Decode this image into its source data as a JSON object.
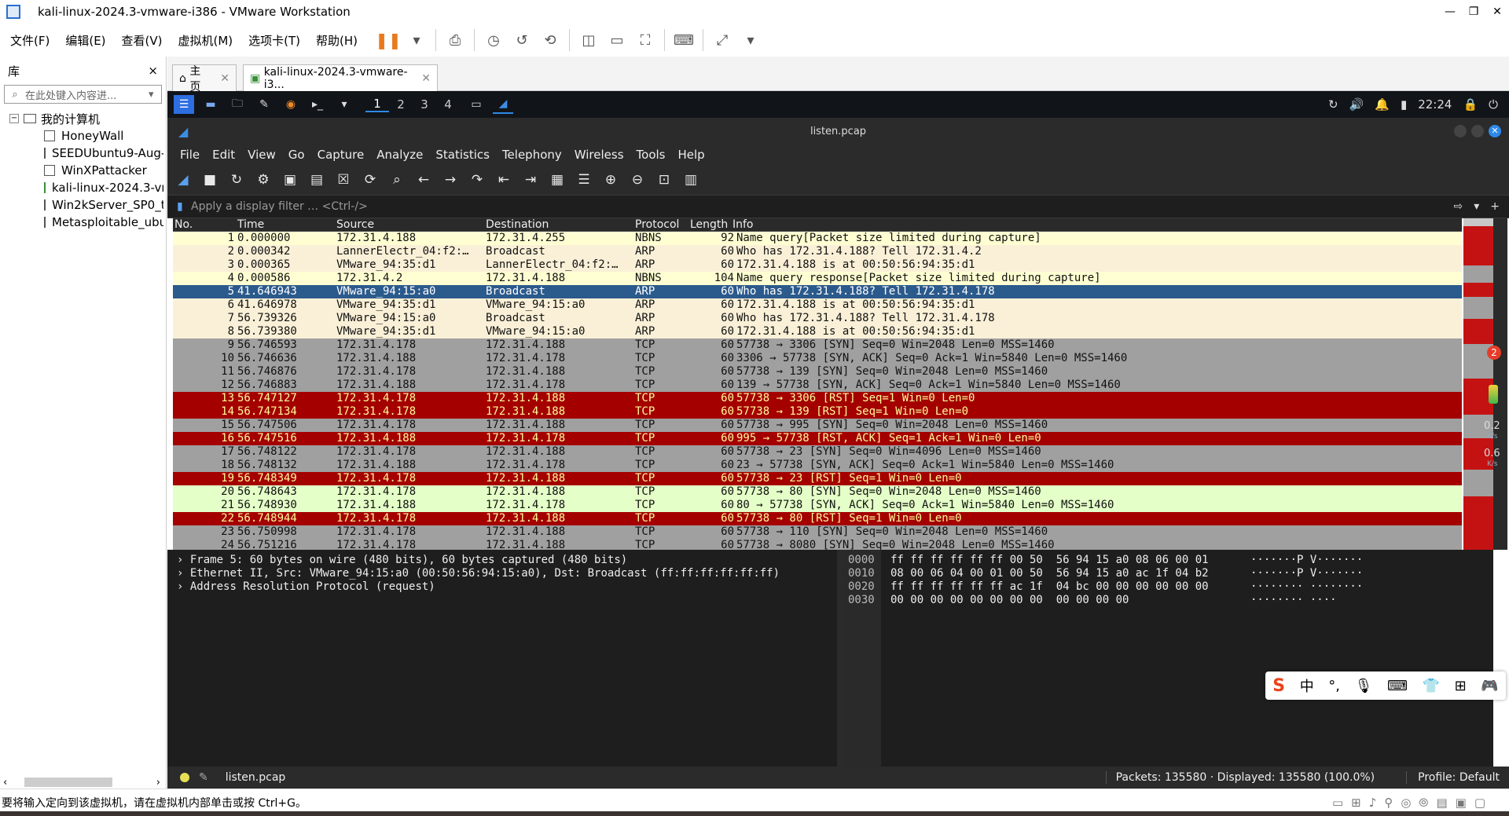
{
  "window": {
    "title": "kali-linux-2024.3-vmware-i386 - VMware Workstation"
  },
  "menubar": {
    "items": [
      "文件(F)",
      "编辑(E)",
      "查看(V)",
      "虚拟机(M)",
      "选项卡(T)",
      "帮助(H)"
    ]
  },
  "library": {
    "title": "库",
    "close": "×",
    "search_placeholder": "在此处键入内容进...",
    "root": "我的计算机",
    "vms": [
      "HoneyWall",
      "SEEDUbuntu9-Aug-2010",
      "WinXPattacker",
      "kali-linux-2024.3-vmware-i386",
      "Win2kServer_SP0_target",
      "Metasploitable_ubuntu"
    ]
  },
  "tabs": {
    "home": "主页",
    "vm": "kali-linux-2024.3-vmware-i3..."
  },
  "kali_panel": {
    "workspaces": [
      "1",
      "2",
      "3",
      "4"
    ],
    "clock": "22:24"
  },
  "wireshark": {
    "title": "listen.pcap",
    "menu": [
      "File",
      "Edit",
      "View",
      "Go",
      "Capture",
      "Analyze",
      "Statistics",
      "Telephony",
      "Wireless",
      "Tools",
      "Help"
    ],
    "filter_placeholder": "Apply a display filter … <Ctrl-/>",
    "columns": {
      "no": "No.",
      "time": "Time",
      "source": "Source",
      "destination": "Destination",
      "protocol": "Protocol",
      "length": "Length",
      "info": "Info"
    },
    "packets": [
      {
        "no": "1",
        "time": "0.000000",
        "src": "172.31.4.188",
        "dst": "172.31.4.255",
        "proto": "NBNS",
        "len": "92",
        "info": "Name query[Packet size limited during capture]",
        "cls": "r-nbns"
      },
      {
        "no": "2",
        "time": "0.000342",
        "src": "LannerElectr_04:f2:…",
        "dst": "Broadcast",
        "proto": "ARP",
        "len": "60",
        "info": "Who has 172.31.4.188? Tell 172.31.4.2",
        "cls": "r-arp"
      },
      {
        "no": "3",
        "time": "0.000365",
        "src": "VMware_94:35:d1",
        "dst": "LannerElectr_04:f2:…",
        "proto": "ARP",
        "len": "60",
        "info": "172.31.4.188 is at 00:50:56:94:35:d1",
        "cls": "r-arp"
      },
      {
        "no": "4",
        "time": "0.000586",
        "src": "172.31.4.2",
        "dst": "172.31.4.188",
        "proto": "NBNS",
        "len": "104",
        "info": "Name query response[Packet size limited during capture]",
        "cls": "r-nbns"
      },
      {
        "no": "5",
        "time": "41.646943",
        "src": "VMware_94:15:a0",
        "dst": "Broadcast",
        "proto": "ARP",
        "len": "60",
        "info": "Who has 172.31.4.188? Tell 172.31.4.178",
        "cls": "r-sel"
      },
      {
        "no": "6",
        "time": "41.646978",
        "src": "VMware_94:35:d1",
        "dst": "VMware_94:15:a0",
        "proto": "ARP",
        "len": "60",
        "info": "172.31.4.188 is at 00:50:56:94:35:d1",
        "cls": "r-arp"
      },
      {
        "no": "7",
        "time": "56.739326",
        "src": "VMware_94:15:a0",
        "dst": "Broadcast",
        "proto": "ARP",
        "len": "60",
        "info": "Who has 172.31.4.188? Tell 172.31.4.178",
        "cls": "r-arp"
      },
      {
        "no": "8",
        "time": "56.739380",
        "src": "VMware_94:35:d1",
        "dst": "VMware_94:15:a0",
        "proto": "ARP",
        "len": "60",
        "info": "172.31.4.188 is at 00:50:56:94:35:d1",
        "cls": "r-arp"
      },
      {
        "no": "9",
        "time": "56.746593",
        "src": "172.31.4.178",
        "dst": "172.31.4.188",
        "proto": "TCP",
        "len": "60",
        "info": "57738 → 3306 [SYN] Seq=0 Win=2048 Len=0 MSS=1460",
        "cls": "r-tcp"
      },
      {
        "no": "10",
        "time": "56.746636",
        "src": "172.31.4.188",
        "dst": "172.31.4.178",
        "proto": "TCP",
        "len": "60",
        "info": "3306 → 57738 [SYN, ACK] Seq=0 Ack=1 Win=5840 Len=0 MSS=1460",
        "cls": "r-tcp"
      },
      {
        "no": "11",
        "time": "56.746876",
        "src": "172.31.4.178",
        "dst": "172.31.4.188",
        "proto": "TCP",
        "len": "60",
        "info": "57738 → 139 [SYN] Seq=0 Win=2048 Len=0 MSS=1460",
        "cls": "r-tcp"
      },
      {
        "no": "12",
        "time": "56.746883",
        "src": "172.31.4.188",
        "dst": "172.31.4.178",
        "proto": "TCP",
        "len": "60",
        "info": "139 → 57738 [SYN, ACK] Seq=0 Ack=1 Win=5840 Len=0 MSS=1460",
        "cls": "r-tcp"
      },
      {
        "no": "13",
        "time": "56.747127",
        "src": "172.31.4.178",
        "dst": "172.31.4.188",
        "proto": "TCP",
        "len": "60",
        "info": "57738 → 3306 [RST] Seq=1 Win=0 Len=0",
        "cls": "r-rst"
      },
      {
        "no": "14",
        "time": "56.747134",
        "src": "172.31.4.178",
        "dst": "172.31.4.188",
        "proto": "TCP",
        "len": "60",
        "info": "57738 → 139 [RST] Seq=1 Win=0 Len=0",
        "cls": "r-rst"
      },
      {
        "no": "15",
        "time": "56.747506",
        "src": "172.31.4.178",
        "dst": "172.31.4.188",
        "proto": "TCP",
        "len": "60",
        "info": "57738 → 995 [SYN] Seq=0 Win=2048 Len=0 MSS=1460",
        "cls": "r-tcp"
      },
      {
        "no": "16",
        "time": "56.747516",
        "src": "172.31.4.188",
        "dst": "172.31.4.178",
        "proto": "TCP",
        "len": "60",
        "info": "995 → 57738 [RST, ACK] Seq=1 Ack=1 Win=0 Len=0",
        "cls": "r-rst"
      },
      {
        "no": "17",
        "time": "56.748122",
        "src": "172.31.4.178",
        "dst": "172.31.4.188",
        "proto": "TCP",
        "len": "60",
        "info": "57738 → 23 [SYN] Seq=0 Win=4096 Len=0 MSS=1460",
        "cls": "r-tcp"
      },
      {
        "no": "18",
        "time": "56.748132",
        "src": "172.31.4.188",
        "dst": "172.31.4.178",
        "proto": "TCP",
        "len": "60",
        "info": "23 → 57738 [SYN, ACK] Seq=0 Ack=1 Win=5840 Len=0 MSS=1460",
        "cls": "r-tcp"
      },
      {
        "no": "19",
        "time": "56.748349",
        "src": "172.31.4.178",
        "dst": "172.31.4.188",
        "proto": "TCP",
        "len": "60",
        "info": "57738 → 23 [RST] Seq=1 Win=0 Len=0",
        "cls": "r-rst"
      },
      {
        "no": "20",
        "time": "56.748643",
        "src": "172.31.4.178",
        "dst": "172.31.4.188",
        "proto": "TCP",
        "len": "60",
        "info": "57738 → 80 [SYN] Seq=0 Win=2048 Len=0 MSS=1460",
        "cls": "r-http"
      },
      {
        "no": "21",
        "time": "56.748930",
        "src": "172.31.4.188",
        "dst": "172.31.4.178",
        "proto": "TCP",
        "len": "60",
        "info": "80 → 57738 [SYN, ACK] Seq=0 Ack=1 Win=5840 Len=0 MSS=1460",
        "cls": "r-http"
      },
      {
        "no": "22",
        "time": "56.748944",
        "src": "172.31.4.178",
        "dst": "172.31.4.188",
        "proto": "TCP",
        "len": "60",
        "info": "57738 → 80 [RST] Seq=1 Win=0 Len=0",
        "cls": "r-rst"
      },
      {
        "no": "23",
        "time": "56.750998",
        "src": "172.31.4.178",
        "dst": "172.31.4.188",
        "proto": "TCP",
        "len": "60",
        "info": "57738 → 110 [SYN] Seq=0 Win=2048 Len=0 MSS=1460",
        "cls": "r-tcp"
      },
      {
        "no": "24",
        "time": "56.751216",
        "src": "172.31.4.178",
        "dst": "172.31.4.188",
        "proto": "TCP",
        "len": "60",
        "info": "57738 → 8080 [SYN] Seq=0 Win=2048 Len=0 MSS=1460",
        "cls": "r-tcp"
      }
    ],
    "details": [
      "Frame 5: 60 bytes on wire (480 bits), 60 bytes captured (480 bits)",
      "Ethernet II, Src: VMware_94:15:a0 (00:50:56:94:15:a0), Dst: Broadcast (ff:ff:ff:ff:ff:ff)",
      "Address Resolution Protocol (request)"
    ],
    "hex": [
      {
        "offset": "0000",
        "bytes": "ff ff ff ff ff ff 00 50  56 94 15 a0 08 06 00 01",
        "ascii": "·······P V·······"
      },
      {
        "offset": "0010",
        "bytes": "08 00 06 04 00 01 00 50  56 94 15 a0 ac 1f 04 b2",
        "ascii": "·······P V·······"
      },
      {
        "offset": "0020",
        "bytes": "ff ff ff ff ff ff ac 1f  04 bc 00 00 00 00 00 00",
        "ascii": "········ ········"
      },
      {
        "offset": "0030",
        "bytes": "00 00 00 00 00 00 00 00  00 00 00 00",
        "ascii": "········ ····"
      }
    ],
    "status": {
      "file": "listen.pcap",
      "packets": "Packets: 135580 · Displayed: 135580 (100.0%)",
      "profile": "Profile: Default"
    }
  },
  "side_indicator": {
    "badge": "2",
    "up": "0.2",
    "down": "0.6",
    "unit": "K/s"
  },
  "ime": {
    "lang": "中"
  },
  "hint": {
    "text": "要将输入定向到该虚拟机，请在虚拟机内部单击或按 Ctrl+G。"
  }
}
